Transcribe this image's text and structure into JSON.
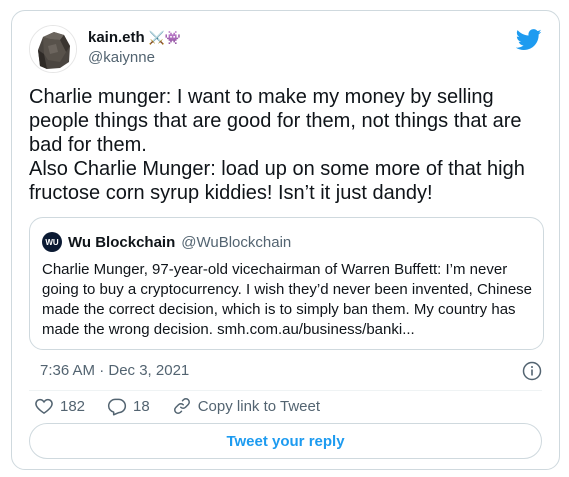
{
  "author": {
    "display_name": "kain.eth",
    "name_emojis": "⚔️👾",
    "handle": "@kaiynne",
    "avatar_icon": "rock-avatar"
  },
  "brand_icon": "twitter-bird-icon",
  "tweet": {
    "text": "Charlie munger: I want to make my money by selling people things that are good for them, not things that are bad for them.\nAlso Charlie Munger: load up on some more of that high fructose corn syrup kiddies! Isn’t it just dandy!"
  },
  "quote": {
    "avatar_text": "WU",
    "display_name": "Wu Blockchain",
    "handle": "@WuBlockchain",
    "text": "Charlie Munger, 97-year-old vicechairman of Warren Buffett: I’m never going to buy a cryptocurrency. I wish they’d never been invented, Chinese made the correct decision, which is to simply ban them. My country has made the wrong decision. smh.com.au/business/banki..."
  },
  "timestamp": "7:36 AM · Dec 3, 2021",
  "actions": {
    "likes": "182",
    "replies": "18",
    "copy_link_label": "Copy link to Tweet"
  },
  "reply_button_label": "Tweet your reply",
  "colors": {
    "accent": "#1d9bf0",
    "muted_text": "#536471",
    "border": "#cfd9de"
  }
}
